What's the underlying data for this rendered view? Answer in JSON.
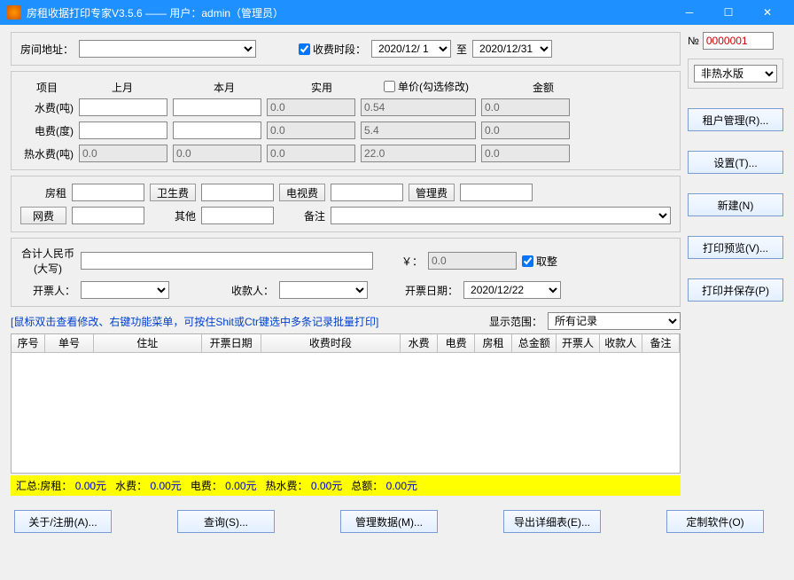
{
  "title": "房租收据打印专家V3.5.6 —— 用户：admin（管理员）",
  "no_label": "№",
  "no_value": "0000001",
  "version_opts": "非热水版",
  "addr_label": "房间地址：",
  "period_chk": "收费时段：",
  "period_from": "2020/12/ 1",
  "period_to_lbl": "至",
  "period_to": "2020/12/31",
  "cols": {
    "item": "项目",
    "last": "上月",
    "this": "本月",
    "usage": "实用",
    "price": "单价(勾选修改)",
    "amount": "金额"
  },
  "rows": {
    "water": {
      "l": "水费(吨)",
      "usage": "0.0",
      "price": "0.54",
      "amount": "0.0"
    },
    "elec": {
      "l": "电费(度)",
      "usage": "0.0",
      "price": "5.4",
      "amount": "0.0"
    },
    "hot": {
      "l": "热水费(吨)",
      "last": "0.0",
      "this": "0.0",
      "usage": "0.0",
      "price": "22.0",
      "amount": "0.0"
    }
  },
  "fees": {
    "rent": "房租",
    "clean": "卫生费",
    "tv": "电视费",
    "mgmt": "管理费",
    "net": "网费",
    "other": "其他",
    "remark": "备注"
  },
  "total": {
    "l1": "合计人民币",
    "l2": "(大写)",
    "yen": "￥：",
    "val": "0.0",
    "round": "取整"
  },
  "ppl": {
    "issuer": "开票人：",
    "receiver": "收款人：",
    "date_l": "开票日期：",
    "date": "2020/12/22"
  },
  "hint": "[鼠标双击查看修改、右键功能菜单，可按住Shit或Ctr键选中多条记录批量打印]",
  "scope_l": "显示范围：",
  "scope": "所有记录",
  "tcols": [
    "序号",
    "单号",
    "住址",
    "开票日期",
    "收费时段",
    "水费",
    "电费",
    "房租",
    "总金额",
    "开票人",
    "收款人",
    "备注"
  ],
  "sum": {
    "pre": "汇总:",
    "rent": "房租：",
    "v1": "0.00元",
    "water": "水费：",
    "v2": "0.00元",
    "elec": "电费：",
    "v3": "0.00元",
    "hot": "热水费：",
    "v4": "0.00元",
    "total": "总额：",
    "v5": "0.00元"
  },
  "rbtns": {
    "tenant": "租户管理(R)...",
    "setting": "设置(T)...",
    "new": "新建(N)",
    "preview": "打印预览(V)...",
    "print": "打印并保存(P)"
  },
  "bbtns": {
    "about": "关于/注册(A)...",
    "query": "查询(S)...",
    "data": "管理数据(M)...",
    "export": "导出详细表(E)...",
    "custom": "定制软件(O)"
  }
}
